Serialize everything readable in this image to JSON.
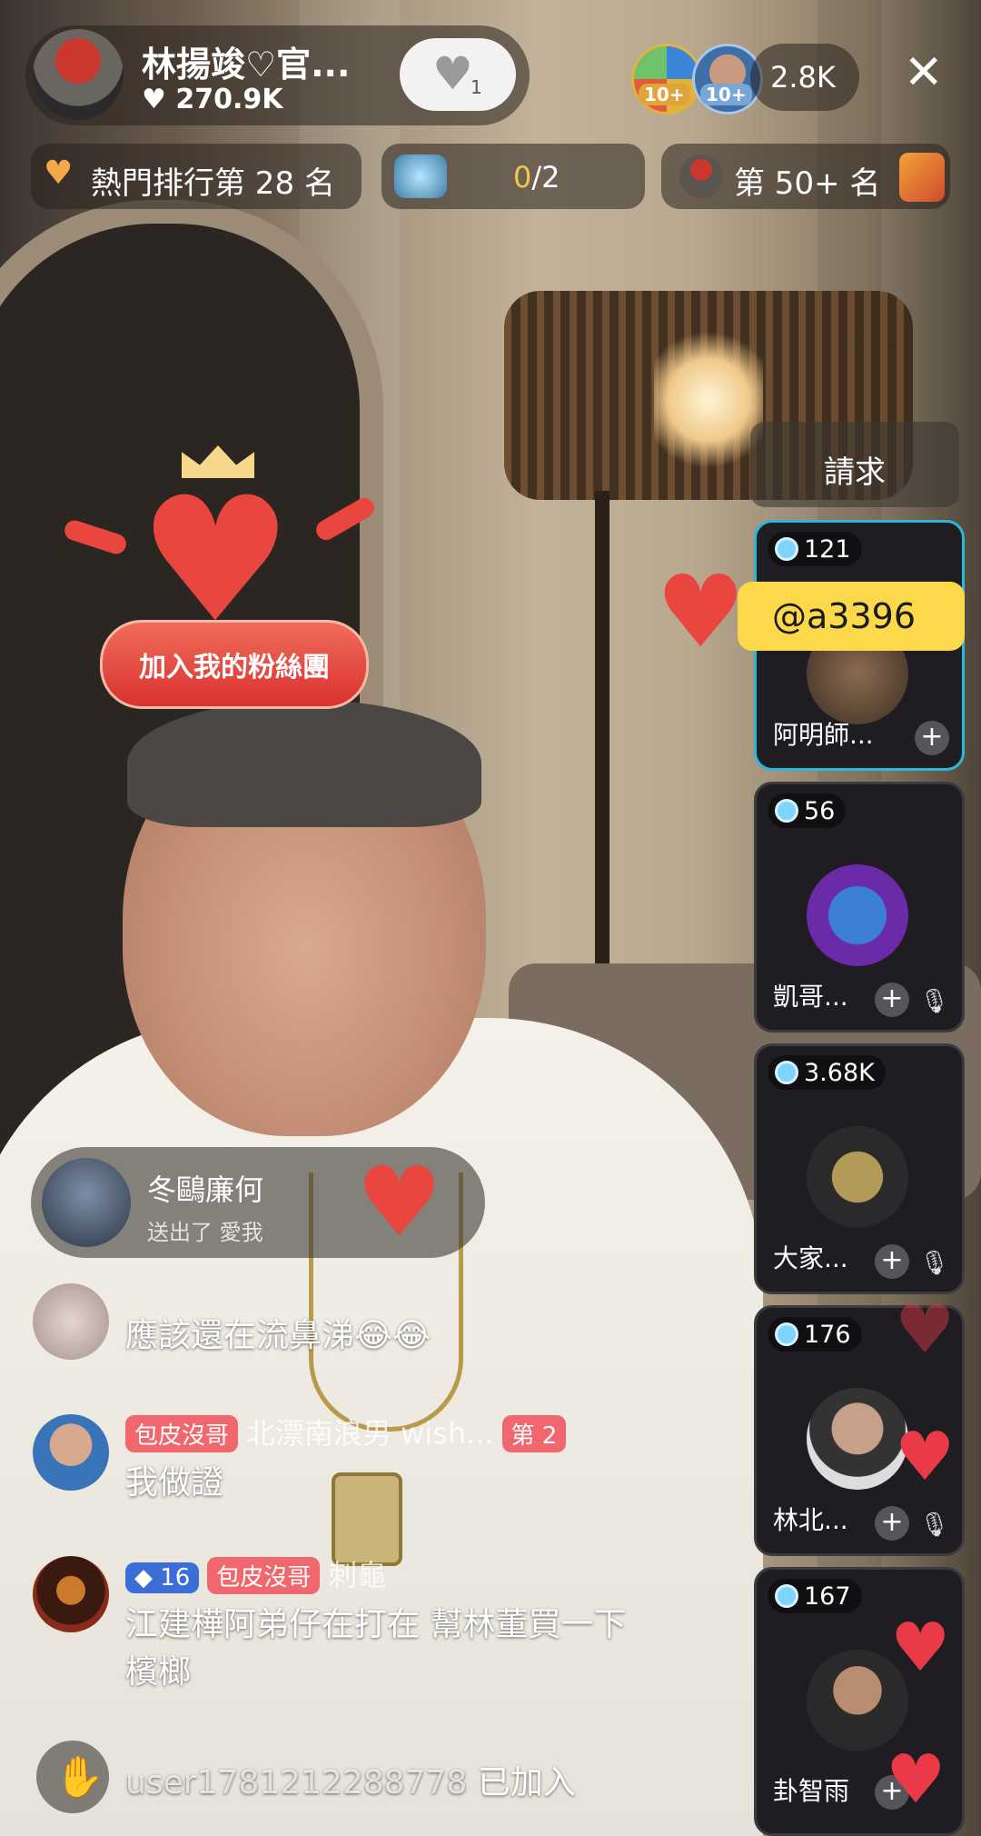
{
  "host": {
    "name": "林揚竣♡官...",
    "likes": "270.9K",
    "like_button_count": "1"
  },
  "top_right": {
    "viewer_badge_1": "10+",
    "viewer_badge_2": "10+",
    "viewer_count": "2.8K",
    "close_symbol": "✕"
  },
  "ranking": {
    "hot_rank": "熱門排行第 28 名",
    "task_progress_current": "0",
    "task_progress_total": "/2",
    "other_rank": "第 50+ 名"
  },
  "fan_club_sticker": {
    "label": "加入我的粉絲團"
  },
  "request_button": "請求",
  "mention_tag": "@a3396",
  "guests": [
    {
      "count": "121",
      "name": "阿明師..."
    },
    {
      "count": "56",
      "name": "凱哥..."
    },
    {
      "count": "3.68K",
      "name": "大家..."
    },
    {
      "count": "176",
      "name": "林北..."
    },
    {
      "count": "167",
      "name": "卦智雨"
    }
  ],
  "gift_notice": {
    "user": "冬鷗廉何",
    "action": "送出了 愛我"
  },
  "chat": [
    {
      "text": "應該還在流鼻涕😂😂"
    },
    {
      "badge": "包皮沒哥",
      "user": "北漂南浪男 wish...",
      "rank_badge": "第 2",
      "text": "我做證"
    },
    {
      "level": "16",
      "badge": "包皮沒哥",
      "user": "刺龜",
      "text_line1": "江建樺阿弟仔在打在 幫林董買一下",
      "text_line2": "檳榔"
    }
  ],
  "join_notice": {
    "user": "user1781212288778",
    "action": "已加入"
  },
  "colors": {
    "accent_red": "#ea3a48",
    "guest_highlight": "#2bb7d9",
    "mention_yellow": "#fbd94a",
    "badge_pink": "#f0686e"
  }
}
